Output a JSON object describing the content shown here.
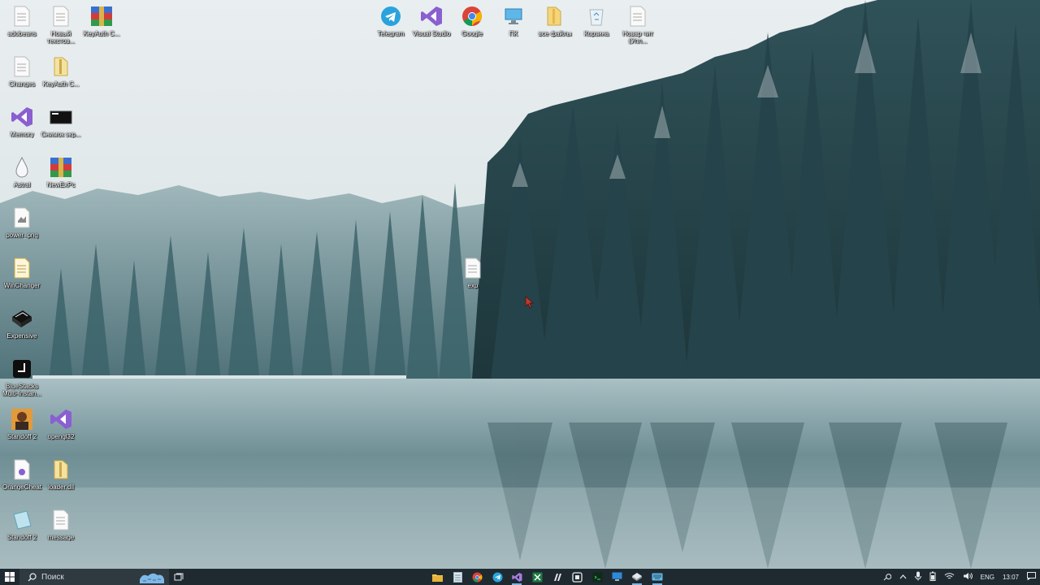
{
  "desktop": {
    "left_icons": [
      {
        "label": "adobeans",
        "icon": "text-file-icon"
      },
      {
        "label": "Новый текстов...",
        "icon": "text-file-icon"
      },
      {
        "label": "KeyAuth C...",
        "icon": "winrar-icon"
      },
      {
        "label": "Changes",
        "icon": "text-file-icon"
      },
      {
        "label": "KeyAuth C...",
        "icon": "folder-icon"
      },
      {
        "label": "Memory",
        "icon": "visual-studio-icon"
      },
      {
        "label": "Снимок экр...",
        "icon": "image-file-icon"
      },
      {
        "label": "Astral",
        "icon": "astral-icon"
      },
      {
        "label": "NewExPc",
        "icon": "winrar-icon"
      },
      {
        "label": "power_png",
        "icon": "image-file-icon"
      },
      {
        "label": "WinChanger",
        "icon": "config-file-icon"
      },
      {
        "label": "Expensive",
        "icon": "expensive-app-icon"
      },
      {
        "label": "BlueStacks Multi-Instan...",
        "icon": "bluestacks-icon"
      },
      {
        "label": "Standoff 2",
        "icon": "standoff-icon"
      },
      {
        "label": "opengl32",
        "icon": "visual-studio-icon"
      },
      {
        "label": "OrangeCheat",
        "icon": "config-file-icon"
      },
      {
        "label": "loader.dll",
        "icon": "dll-file-icon"
      },
      {
        "label": "Standoff 2",
        "icon": "standoff-folder-icon"
      },
      {
        "label": "message",
        "icon": "text-file-icon"
      }
    ],
    "top_icons": [
      {
        "label": "Telegram",
        "icon": "telegram-icon"
      },
      {
        "label": "Visual Studio",
        "icon": "visual-studio-icon"
      },
      {
        "label": "Google",
        "icon": "chrome-icon"
      },
      {
        "label": "ПК",
        "icon": "this-pc-icon"
      },
      {
        "label": "все файлы",
        "icon": "folder-icon"
      },
      {
        "label": "Корзина",
        "icon": "recycle-bin-icon"
      },
      {
        "label": "Новар чит (Упл...",
        "icon": "text-file-icon"
      }
    ],
    "center_icon": {
      "label": "exp",
      "icon": "text-file-icon"
    }
  },
  "taskbar": {
    "search_placeholder": "Поиск",
    "apps": [
      {
        "name": "file-explorer-icon"
      },
      {
        "name": "notepad-icon"
      },
      {
        "name": "chrome-icon"
      },
      {
        "name": "telegram-icon"
      },
      {
        "name": "visual-studio-icon"
      },
      {
        "name": "excel-icon"
      },
      {
        "name": "app-n-icon"
      },
      {
        "name": "store-icon"
      },
      {
        "name": "terminal-icon"
      },
      {
        "name": "monitor-icon"
      },
      {
        "name": "expensive-app-icon"
      },
      {
        "name": "keyboard-icon"
      }
    ],
    "tray": {
      "language": "ENG",
      "time": "13:07"
    }
  },
  "colors": {
    "taskbar": "#1f2a30",
    "search_box": "#2e3a40"
  }
}
